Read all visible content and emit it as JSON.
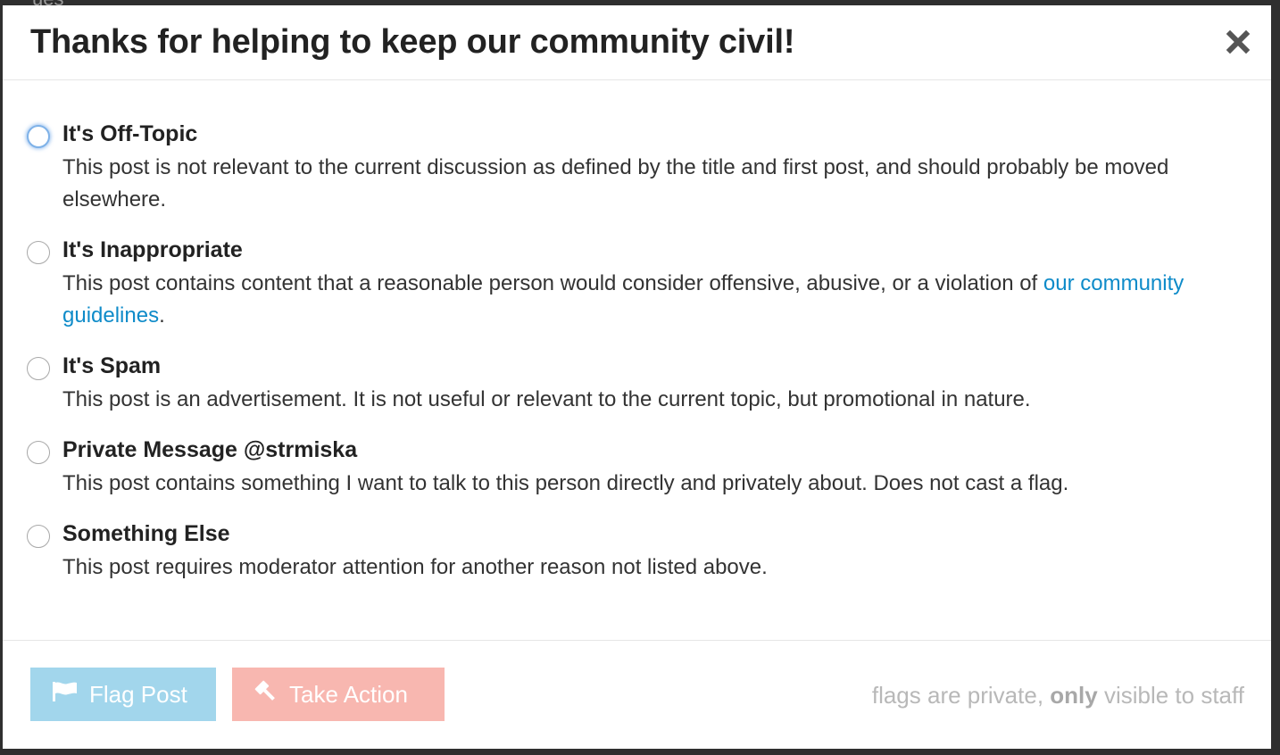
{
  "background": {
    "text": "ues"
  },
  "modal": {
    "title": "Thanks for helping to keep our community civil!",
    "close_icon": "close-icon"
  },
  "options": [
    {
      "title": "It's Off-Topic",
      "description": "This post is not relevant to the current discussion as defined by the title and first post, and should probably be moved elsewhere.",
      "focused": true
    },
    {
      "title": "It's Inappropriate",
      "description_before": "This post contains content that a reasonable person would consider offensive, abusive, or a violation of ",
      "link": "our community guidelines",
      "description_after": ".",
      "focused": false
    },
    {
      "title": "It's Spam",
      "description": "This post is an advertisement. It is not useful or relevant to the current topic, but promotional in nature.",
      "focused": false
    },
    {
      "title": "Private Message @strmiska",
      "description": "This post contains something I want to talk to this person directly and privately about. Does not cast a flag.",
      "focused": false
    },
    {
      "title": "Something Else",
      "description": "This post requires moderator attention for another reason not listed above.",
      "focused": false
    }
  ],
  "footer": {
    "flag_button": "Flag Post",
    "flag_icon": "flag-icon",
    "action_button": "Take Action",
    "action_icon": "gavel-icon",
    "note_before": "flags are private, ",
    "note_bold": "only",
    "note_after": " visible to staff"
  },
  "colors": {
    "link": "#0e8bc9",
    "flag_button_bg": "#a2d6ec",
    "action_button_bg": "#f8b7b0",
    "radio_focus": "#7fb2e8"
  }
}
